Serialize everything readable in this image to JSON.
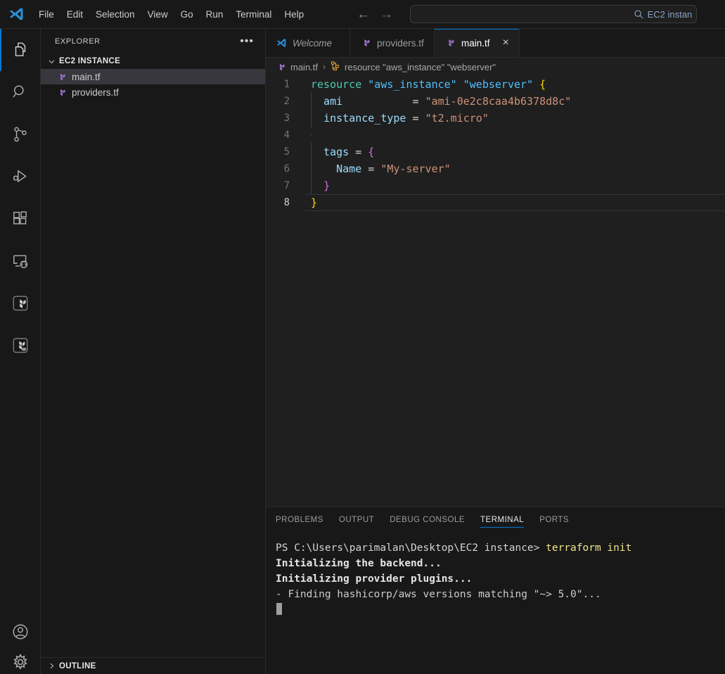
{
  "titlebar": {
    "logo_icon": "vscode-logo-icon",
    "menus": [
      "File",
      "Edit",
      "Selection",
      "View",
      "Go",
      "Run",
      "Terminal",
      "Help"
    ],
    "nav_back_icon": "arrow-left-icon",
    "nav_forward_icon": "arrow-right-icon",
    "search": {
      "icon": "search-icon",
      "value": "EC2 instan",
      "placeholder": "Search"
    }
  },
  "activitybar": {
    "top_items": [
      {
        "name": "explorer",
        "icon": "files-icon",
        "active": true
      },
      {
        "name": "search",
        "icon": "search-icon",
        "active": false
      },
      {
        "name": "source-control",
        "icon": "source-control-icon",
        "active": false
      },
      {
        "name": "run-and-debug",
        "icon": "run-debug-icon",
        "active": false
      },
      {
        "name": "extensions",
        "icon": "extensions-icon",
        "active": false
      },
      {
        "name": "remote-explorer",
        "icon": "remote-explorer-icon",
        "active": false
      },
      {
        "name": "terraform",
        "icon": "terraform-icon",
        "active": false
      },
      {
        "name": "terraform-cloud",
        "icon": "terraform-cloud-icon",
        "active": false
      }
    ],
    "bottom_items": [
      {
        "name": "accounts",
        "icon": "account-icon"
      },
      {
        "name": "manage-settings",
        "icon": "gear-icon"
      }
    ]
  },
  "sidebar": {
    "title": "EXPLORER",
    "more_actions_label": "•••",
    "folder": {
      "name": "EC2 INSTANCE",
      "expanded": true,
      "chevron": "⌄"
    },
    "files": [
      {
        "label": "main.tf",
        "icon": "terraform-file-icon",
        "selected": true
      },
      {
        "label": "providers.tf",
        "icon": "terraform-file-icon",
        "selected": false
      }
    ],
    "outline": {
      "label": "OUTLINE",
      "expanded": false,
      "chevron": "›"
    }
  },
  "editor": {
    "tabs": [
      {
        "label": "Welcome",
        "icon": "vscode-logo-icon",
        "active": false,
        "preview": true,
        "closable": false
      },
      {
        "label": "providers.tf",
        "icon": "terraform-file-icon",
        "active": false,
        "preview": false,
        "closable": false
      },
      {
        "label": "main.tf",
        "icon": "terraform-file-icon",
        "active": true,
        "preview": false,
        "closable": true,
        "close_label": "×"
      }
    ],
    "breadcrumb": {
      "file": "main.tf",
      "file_icon": "terraform-file-icon",
      "separator": "›",
      "symbol": "resource \"aws_instance\" \"webserver\"",
      "symbol_icon": "symbol-structure-icon"
    },
    "code_lines": [
      {
        "num": "1",
        "current": false,
        "indent_guide": false,
        "tokens": [
          {
            "t": "resource",
            "c": "k-res"
          },
          {
            "t": " ",
            "c": "k-op"
          },
          {
            "t": "\"aws_instance\"",
            "c": "k-strb"
          },
          {
            "t": " ",
            "c": "k-op"
          },
          {
            "t": "\"webserver\"",
            "c": "k-strb"
          },
          {
            "t": " ",
            "c": "k-op"
          },
          {
            "t": "{",
            "c": "k-br-y"
          }
        ]
      },
      {
        "num": "2",
        "current": false,
        "indent_guide": true,
        "tokens": [
          {
            "t": "  ami           ",
            "c": "k-prop"
          },
          {
            "t": "= ",
            "c": "k-op"
          },
          {
            "t": "\"ami-0e2c8caa4b6378d8c\"",
            "c": "k-str"
          }
        ]
      },
      {
        "num": "3",
        "current": false,
        "indent_guide": true,
        "tokens": [
          {
            "t": "  instance_type ",
            "c": "k-prop"
          },
          {
            "t": "= ",
            "c": "k-op"
          },
          {
            "t": "\"t2.micro\"",
            "c": "k-str"
          }
        ]
      },
      {
        "num": "4",
        "current": false,
        "indent_guide": true,
        "tokens": []
      },
      {
        "num": "5",
        "current": false,
        "indent_guide": true,
        "tokens": [
          {
            "t": "  tags ",
            "c": "k-prop"
          },
          {
            "t": "= ",
            "c": "k-op"
          },
          {
            "t": "{",
            "c": "k-br-p"
          }
        ]
      },
      {
        "num": "6",
        "current": false,
        "indent_guide": true,
        "tokens": [
          {
            "t": "    Name ",
            "c": "k-prop"
          },
          {
            "t": "= ",
            "c": "k-op"
          },
          {
            "t": "\"My-server\"",
            "c": "k-str"
          }
        ]
      },
      {
        "num": "7",
        "current": false,
        "indent_guide": true,
        "tokens": [
          {
            "t": "  ",
            "c": "k-op"
          },
          {
            "t": "}",
            "c": "k-br-p"
          }
        ]
      },
      {
        "num": "8",
        "current": true,
        "indent_guide": false,
        "tokens": [
          {
            "t": "}",
            "c": "k-br-y"
          }
        ]
      }
    ]
  },
  "panel": {
    "tabs": [
      {
        "label": "PROBLEMS",
        "active": false
      },
      {
        "label": "OUTPUT",
        "active": false
      },
      {
        "label": "DEBUG CONSOLE",
        "active": false
      },
      {
        "label": "TERMINAL",
        "active": true
      },
      {
        "label": "PORTS",
        "active": false
      }
    ],
    "terminal_lines": [
      {
        "segments": [
          {
            "t": "PS C:\\Users\\parimalan\\Desktop\\EC2 instance> ",
            "c": "t-path"
          },
          {
            "t": "terraform init",
            "c": "t-cmd"
          }
        ]
      },
      {
        "segments": [
          {
            "t": "Initializing the backend...",
            "c": "t-bold"
          }
        ]
      },
      {
        "segments": [
          {
            "t": "Initializing provider plugins...",
            "c": "t-bold"
          }
        ]
      },
      {
        "segments": [
          {
            "t": "- Finding hashicorp/aws versions matching \"~> 5.0\"...",
            "c": "t-plain"
          }
        ]
      }
    ],
    "cursor_visible": true
  },
  "colors": {
    "accent": "#0078d4",
    "editor_bg": "#1f1f1f",
    "chrome_bg": "#181818",
    "selection_bg": "#37373d",
    "terraform_purple": "#7b42bc",
    "keyword_green": "#4ec9b0",
    "string_orange": "#ce9178",
    "property_blue": "#9cdcfe"
  }
}
